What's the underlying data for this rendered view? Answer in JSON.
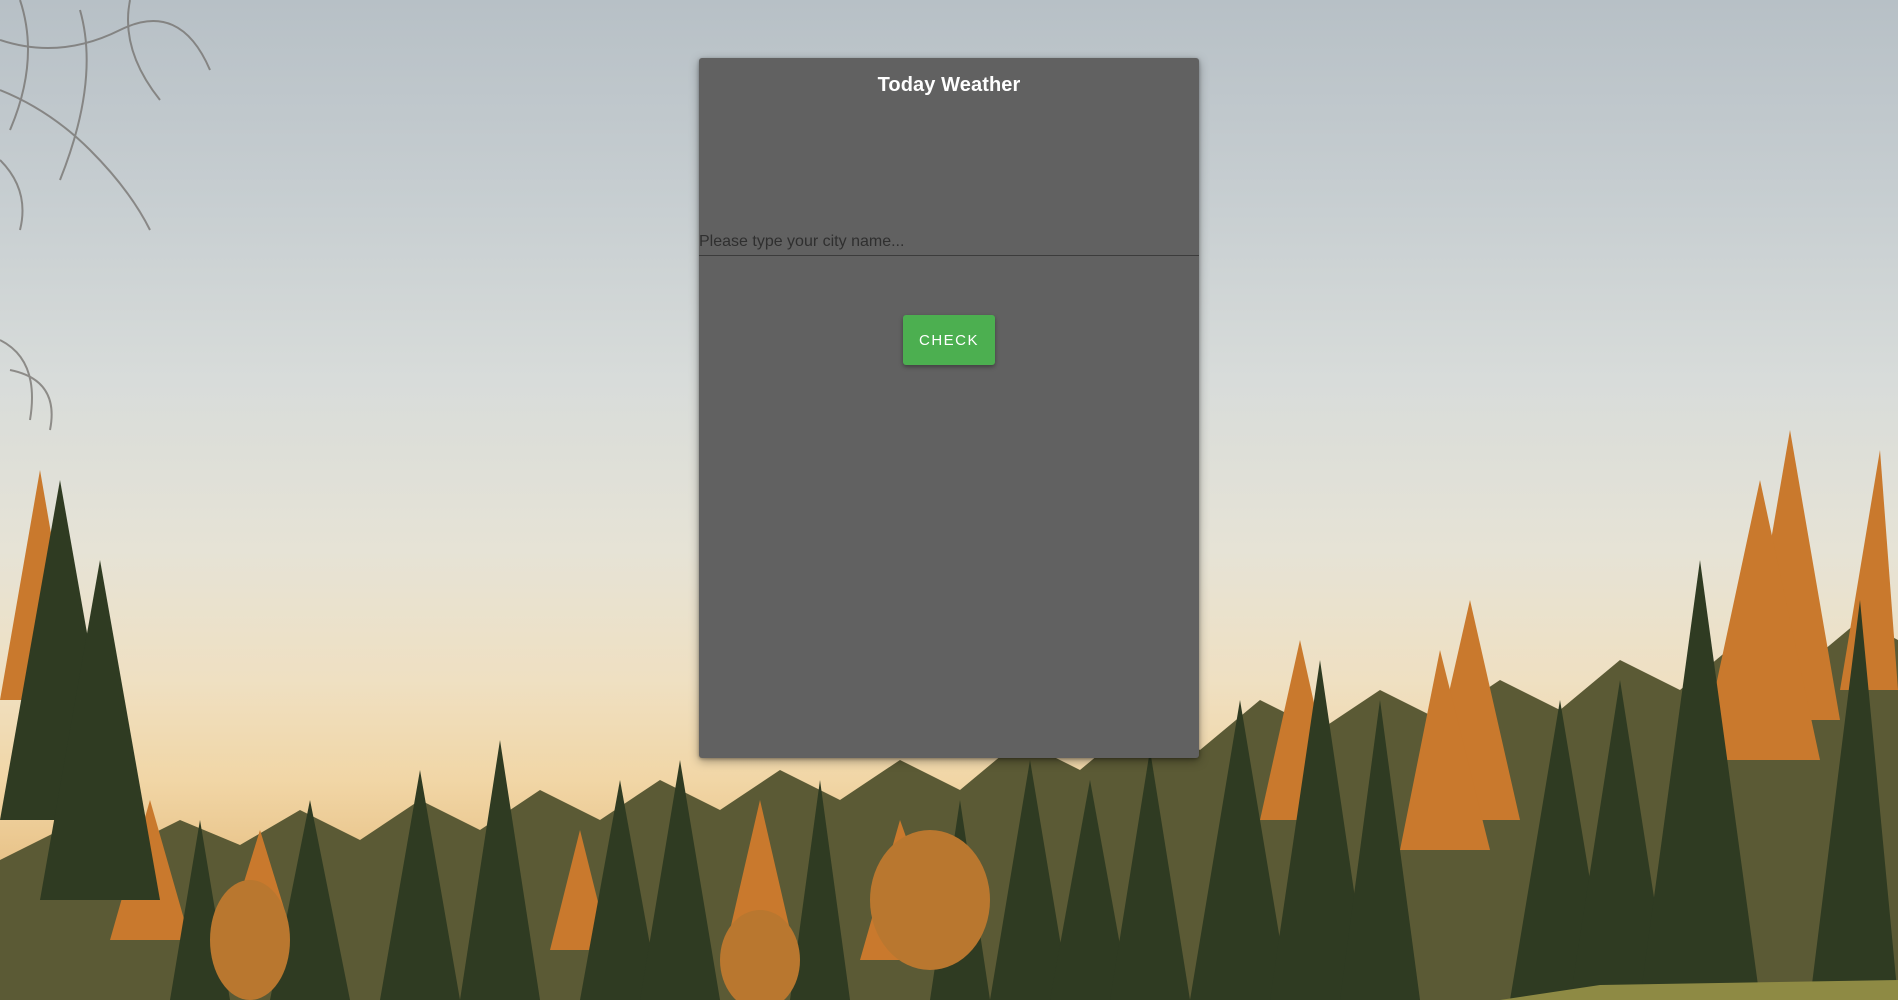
{
  "card": {
    "title": "Today Weather",
    "city_input": {
      "placeholder": "Please type your city name...",
      "value": ""
    },
    "check_button": {
      "label": "CHECK"
    }
  },
  "colors": {
    "card_background": "#616161",
    "button_background": "#4caf50",
    "title_text": "#ffffff"
  },
  "background": {
    "description_icon": "autumn-forest-background"
  }
}
